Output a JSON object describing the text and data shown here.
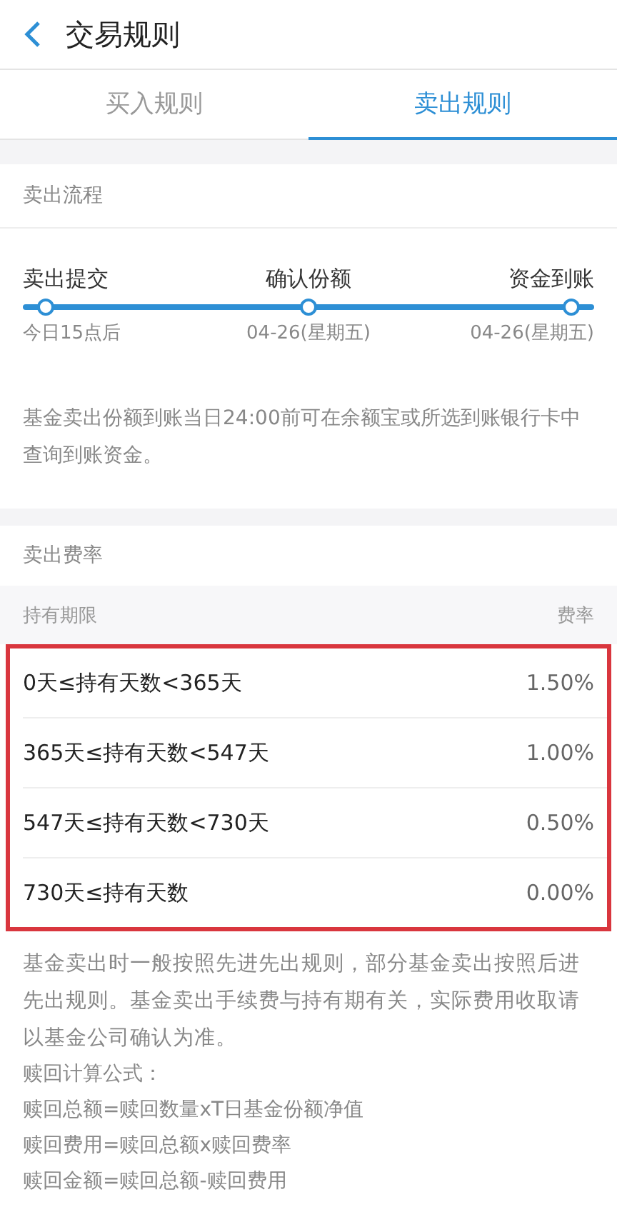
{
  "header": {
    "title": "交易规则"
  },
  "tabs": [
    {
      "label": "买入规则",
      "selected": false
    },
    {
      "label": "卖出规则",
      "selected": true
    }
  ],
  "sell_flow": {
    "title": "卖出流程",
    "steps": [
      {
        "label": "卖出提交",
        "date": "今日15点后"
      },
      {
        "label": "确认份额",
        "date": "04-26(星期五)"
      },
      {
        "label": "资金到账",
        "date": "04-26(星期五)"
      }
    ],
    "note": "基金卖出份额到账当日24:00前可在余额宝或所选到账银行卡中查询到账资金。"
  },
  "sell_fees": {
    "title": "卖出费率",
    "columns": [
      "持有期限",
      "费率"
    ],
    "highlighted": true,
    "rows": [
      {
        "period": "0天≤持有天数<365天",
        "rate": "1.50%"
      },
      {
        "period": "365天≤持有天数<547天",
        "rate": "1.00%"
      },
      {
        "period": "547天≤持有天数<730天",
        "rate": "0.50%"
      },
      {
        "period": "730天≤持有天数",
        "rate": "0.00%"
      }
    ]
  },
  "notes": [
    "基金卖出时一般按照先进先出规则，部分基金卖出按照后进先出规则。基金卖出手续费与持有期有关，实际费用收取请以基金公司确认为准。",
    "赎回计算公式：",
    "赎回总额=赎回数量xT日基金份额净值",
    "赎回费用=赎回总额x赎回费率",
    "赎回金额=赎回总额-赎回费用"
  ]
}
